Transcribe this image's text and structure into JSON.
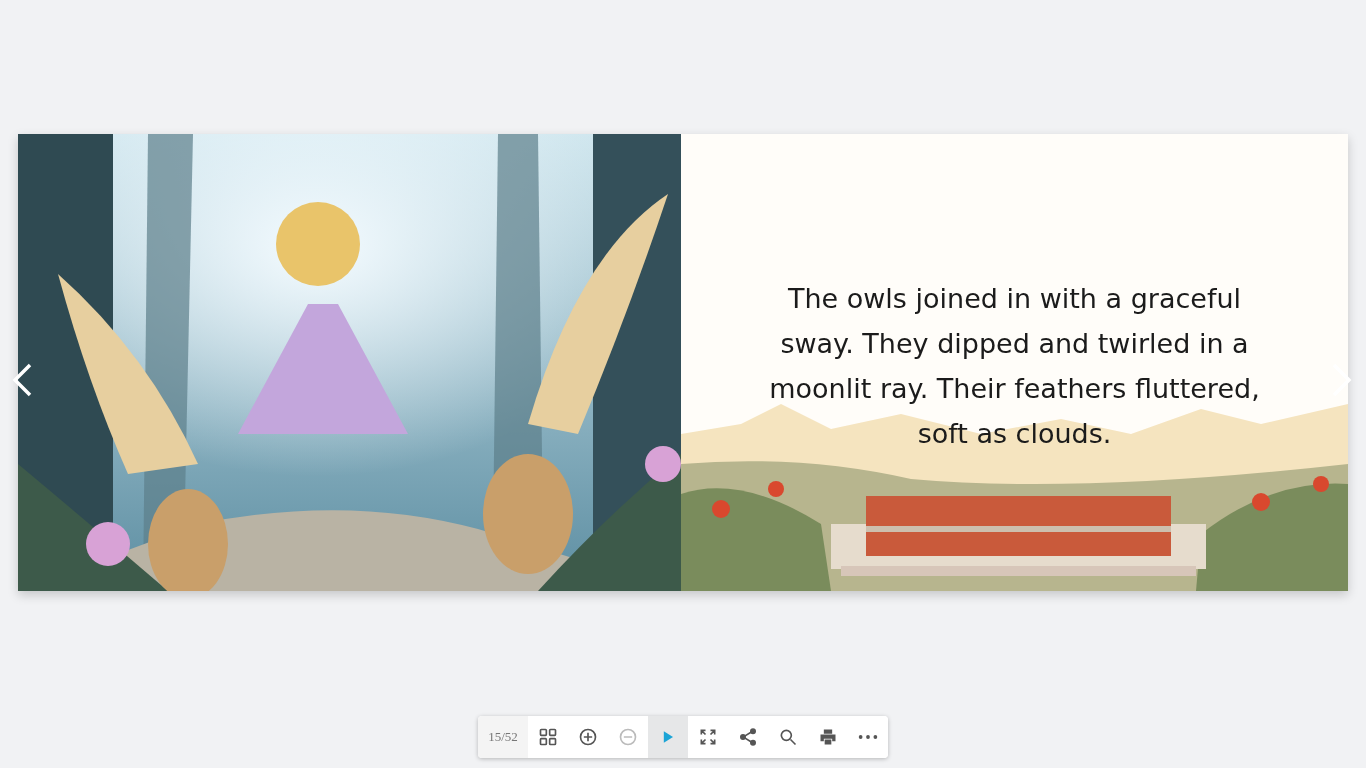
{
  "book": {
    "right_page": {
      "text": "The owls joined in with a graceful sway. They dipped and twirled in a moonlit ray. Their feathers fluttered, soft as clouds."
    }
  },
  "toolbar": {
    "page_counter": "15/52",
    "buttons": [
      {
        "kind": "thumbnails",
        "disabled": false,
        "highlighted": false
      },
      {
        "kind": "zoom-in",
        "disabled": false,
        "highlighted": false
      },
      {
        "kind": "zoom-out",
        "disabled": true,
        "highlighted": false
      },
      {
        "kind": "play",
        "disabled": false,
        "highlighted": true
      },
      {
        "kind": "fullscreen",
        "disabled": false,
        "highlighted": false
      },
      {
        "kind": "share",
        "disabled": false,
        "highlighted": false
      },
      {
        "kind": "search",
        "disabled": false,
        "highlighted": false
      },
      {
        "kind": "print",
        "disabled": false,
        "highlighted": false
      },
      {
        "kind": "more",
        "disabled": false,
        "highlighted": false
      }
    ]
  }
}
